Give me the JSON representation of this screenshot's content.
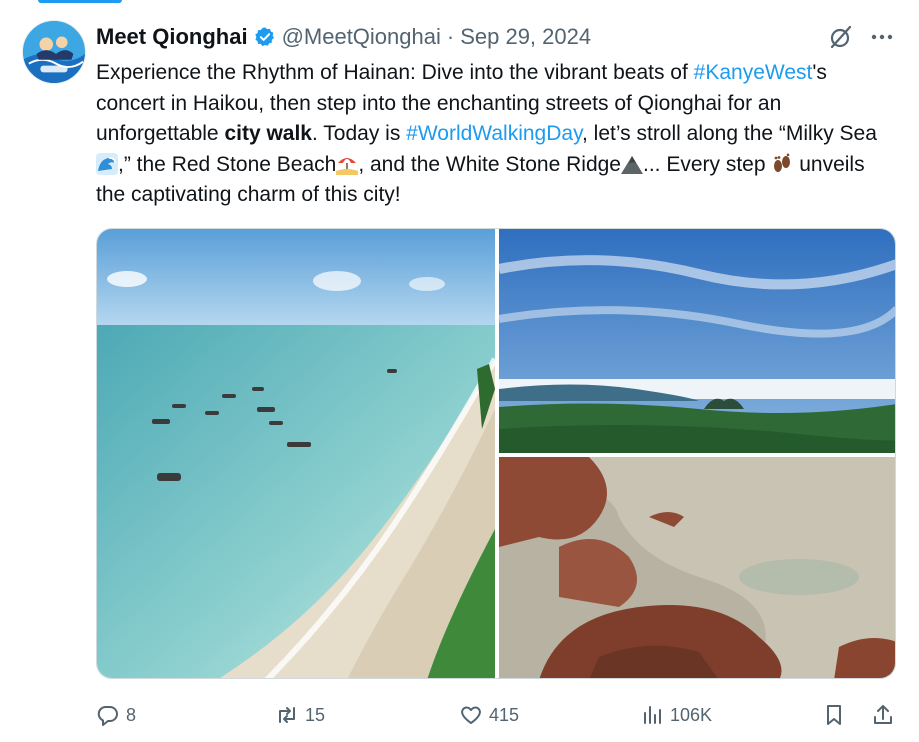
{
  "author": {
    "display_name": "Meet Qionghai",
    "handle": "@MeetQionghai",
    "separator": "·",
    "date": "Sep 29, 2024",
    "verified_color": "#1d9bf0"
  },
  "tweet": {
    "t1": "Experience the Rhythm of Hainan: Dive into the vibrant beats of ",
    "hashtag1": "#KanyeWest",
    "t2": "'s concert in Haikou, then step into the enchanting streets of Qionghai for an unforgettable ",
    "bold1": "city walk",
    "t3": ". Today is ",
    "hashtag2": "#WorldWalkingDay",
    "t4": ", let’s stroll along the “Milky Sea",
    "t5": ",” the Red Stone Beach",
    "t6": ", and the White Stone Ridge",
    "t7": "... Every step ",
    "t8": "unveils the captivating charm of this city!",
    "emoji1": "wave-emoji",
    "emoji2": "beach-umbrella-emoji",
    "emoji3": "mountain-emoji",
    "emoji4": "footprints-emoji",
    "link_color": "#1d9bf0"
  },
  "media": [
    {
      "name": "aerial-beach-boats-photo"
    },
    {
      "name": "mountain-fog-landscape-photo"
    },
    {
      "name": "red-stone-beach-photo"
    }
  ],
  "actions": {
    "replies": "8",
    "reposts": "15",
    "likes": "415",
    "views": "106K"
  },
  "icons": {
    "reply": "reply-icon",
    "repost": "repost-icon",
    "like": "heart-icon",
    "views": "views-chart-icon",
    "bookmark": "bookmark-icon",
    "share": "share-icon",
    "grok": "grok-icon",
    "more": "more-dots-icon"
  }
}
